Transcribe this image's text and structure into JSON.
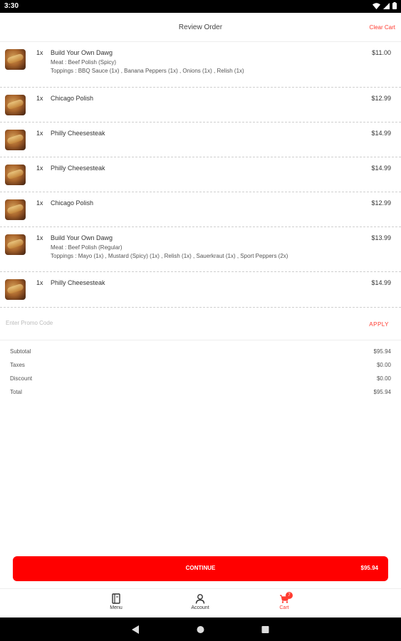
{
  "status_bar": {
    "time": "3:30"
  },
  "header": {
    "title": "Review Order",
    "clear_cart": "Clear Cart"
  },
  "items": [
    {
      "qty": "1x",
      "name": "Build Your Own Dawg",
      "price": "$11.00",
      "details": [
        "Meat : Beef Polish (Spicy)",
        "Toppings : BBQ Sauce (1x) , Banana Peppers (1x) , Onions (1x) , Relish (1x)"
      ]
    },
    {
      "qty": "1x",
      "name": "Chicago Polish",
      "price": "$12.99",
      "details": []
    },
    {
      "qty": "1x",
      "name": "Philly Cheesesteak",
      "price": "$14.99",
      "details": []
    },
    {
      "qty": "1x",
      "name": "Philly Cheesesteak",
      "price": "$14.99",
      "details": []
    },
    {
      "qty": "1x",
      "name": "Chicago Polish",
      "price": "$12.99",
      "details": []
    },
    {
      "qty": "1x",
      "name": "Build Your Own Dawg",
      "price": "$13.99",
      "details": [
        "Meat : Beef Polish (Regular)",
        "Toppings : Mayo (1x) , Mustard (Spicy) (1x) , Relish (1x) , Sauerkraut (1x) , Sport Peppers (2x)"
      ]
    },
    {
      "qty": "1x",
      "name": "Philly Cheesesteak",
      "price": "$14.99",
      "details": []
    }
  ],
  "promo": {
    "placeholder": "Enter Promo Code",
    "apply_label": "APPLY"
  },
  "summary": [
    {
      "label": "Subtotal",
      "value": "$95.94"
    },
    {
      "label": "Taxes",
      "value": "$0.00"
    },
    {
      "label": "Discount",
      "value": "$0.00"
    },
    {
      "label": "Total",
      "value": "$95.94"
    }
  ],
  "continue": {
    "label": "CONTINUE",
    "total": "$95.94"
  },
  "bottom_nav": {
    "menu": "Menu",
    "account": "Account",
    "cart": "Cart",
    "cart_badge": "7"
  },
  "colors": {
    "accent": "#ff0000",
    "link": "#ff3b30"
  }
}
